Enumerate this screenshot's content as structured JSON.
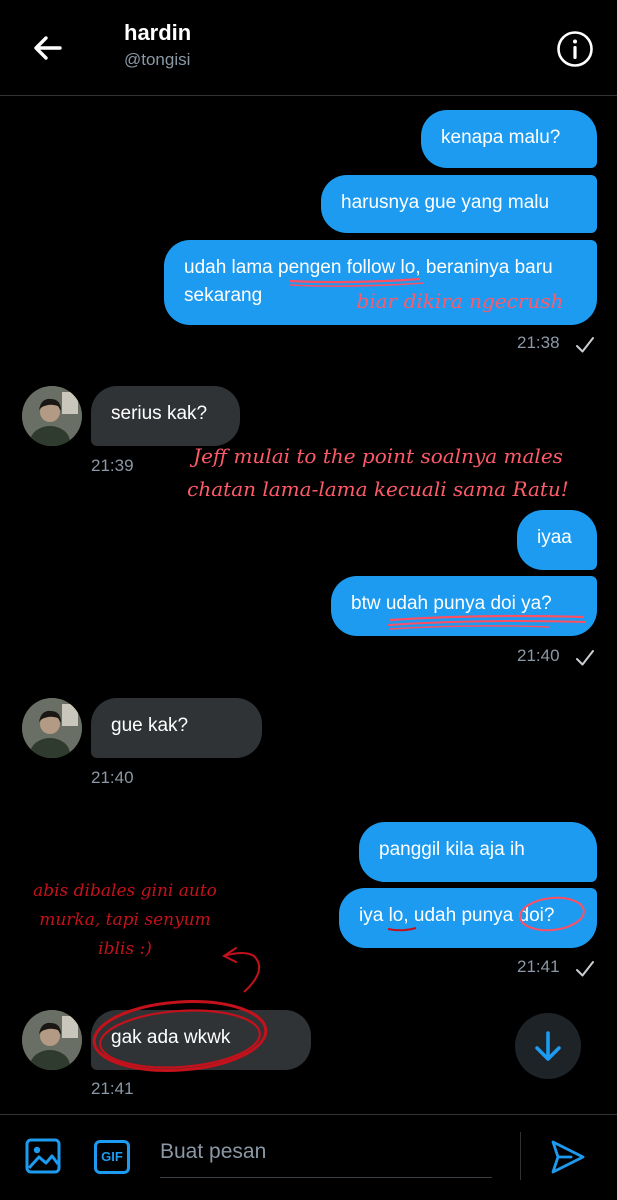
{
  "header": {
    "name": "hardin",
    "handle": "@tongisi",
    "back_icon": "arrow-left-icon",
    "info_icon": "info-circle-icon"
  },
  "messages": [
    {
      "direction": "outgoing",
      "text": "kenapa malu?"
    },
    {
      "direction": "outgoing",
      "text": "harusnya gue yang malu"
    },
    {
      "direction": "outgoing",
      "text": "udah lama pengen follow lo, beraninya baru sekarang"
    },
    {
      "direction": "outgoing",
      "time": "21:38",
      "status": "sent"
    },
    {
      "direction": "incoming",
      "text": "serius kak?",
      "time": "21:39"
    },
    {
      "direction": "outgoing",
      "text": "iyaa"
    },
    {
      "direction": "outgoing",
      "text": "btw udah punya doi ya?",
      "time": "21:40",
      "status": "sent"
    },
    {
      "direction": "incoming",
      "text": "gue kak?",
      "time": "21:40"
    },
    {
      "direction": "outgoing",
      "text": "panggil kila aja ih"
    },
    {
      "direction": "outgoing",
      "text": "iya lo, udah punya doi?",
      "time": "21:41",
      "status": "sent"
    },
    {
      "direction": "incoming",
      "text": "gak ada wkwk",
      "time": "21:41"
    }
  ],
  "annotations": [
    {
      "text": "biar dikira ngecrush"
    },
    {
      "text": "Jeff mulai to the point soalnya males chatan lama-lama kecuali sama Ratu!"
    },
    {
      "text": "abis dibales gini auto murka, tapi senyum iblis :)"
    }
  ],
  "composer": {
    "placeholder": "Buat pesan",
    "gif_label": "GIF",
    "media_icon": "image-icon",
    "send_icon": "send-icon"
  },
  "scroll_down_icon": "arrow-down-icon",
  "colors": {
    "background": "#000000",
    "outgoing_bubble": "#1d9bf0",
    "incoming_bubble": "#2f3336",
    "muted_text": "#8b98a5",
    "annotation_pink": "#ff5a6a",
    "annotation_red": "#c4111b"
  }
}
